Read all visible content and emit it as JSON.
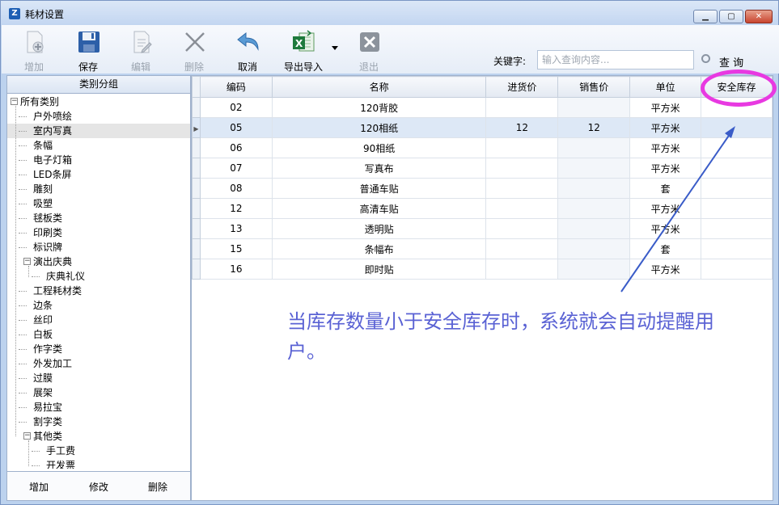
{
  "window": {
    "title": "耗材设置"
  },
  "toolbar": {
    "buttons": [
      {
        "id": "add",
        "label": "增加",
        "icon": "document-plus-icon",
        "enabled": false
      },
      {
        "id": "save",
        "label": "保存",
        "icon": "floppy-disk-icon",
        "enabled": true
      },
      {
        "id": "edit",
        "label": "编辑",
        "icon": "document-edit-icon",
        "enabled": false
      },
      {
        "id": "delete",
        "label": "删除",
        "icon": "x-cross-icon",
        "enabled": false
      },
      {
        "id": "cancel",
        "label": "取消",
        "icon": "undo-arrow-icon",
        "enabled": true
      },
      {
        "id": "export",
        "label": "导出导入",
        "icon": "excel-icon",
        "enabled": true
      },
      {
        "id": "exit",
        "label": "退出",
        "icon": "exit-x-icon",
        "enabled": false
      }
    ],
    "keyword_label": "关键字:",
    "search_placeholder": "输入查询内容...",
    "search_button": "查 询"
  },
  "left_panel": {
    "header": "类别分组",
    "footer_buttons": [
      "增加",
      "修改",
      "删除"
    ],
    "tree": [
      {
        "label": "所有类别",
        "level": 0,
        "expander": "−"
      },
      {
        "label": "户外喷绘",
        "level": 1
      },
      {
        "label": "室内写真",
        "level": 1,
        "selected": true
      },
      {
        "label": "条幅",
        "level": 1
      },
      {
        "label": "电子灯箱",
        "level": 1
      },
      {
        "label": "LED条屏",
        "level": 1
      },
      {
        "label": "雕刻",
        "level": 1
      },
      {
        "label": "吸塑",
        "level": 1
      },
      {
        "label": "毬板类",
        "level": 1
      },
      {
        "label": "印刷类",
        "level": 1
      },
      {
        "label": "标识牌",
        "level": 1
      },
      {
        "label": "演出庆典",
        "level": 1,
        "expander": "−"
      },
      {
        "label": "庆典礼仪",
        "level": 2
      },
      {
        "label": "工程耗材类",
        "level": 1
      },
      {
        "label": "边条",
        "level": 1
      },
      {
        "label": "丝印",
        "level": 1
      },
      {
        "label": "白板",
        "level": 1
      },
      {
        "label": "作字类",
        "level": 1
      },
      {
        "label": "外发加工",
        "level": 1
      },
      {
        "label": "过膜",
        "level": 1
      },
      {
        "label": "展架",
        "level": 1
      },
      {
        "label": "易拉宝",
        "level": 1
      },
      {
        "label": "割字类",
        "level": 1
      },
      {
        "label": "其他类",
        "level": 1,
        "expander": "−"
      },
      {
        "label": "手工费",
        "level": 2
      },
      {
        "label": "开发票",
        "level": 2
      }
    ]
  },
  "grid": {
    "columns": [
      "编码",
      "名称",
      "进货价",
      "销售价",
      "单位",
      "安全库存"
    ],
    "rows": [
      {
        "code": "02",
        "name": "120背胶",
        "buy": "",
        "sell": "",
        "unit": "平方米",
        "safety": ""
      },
      {
        "code": "05",
        "name": "120相纸",
        "buy": "12",
        "sell": "12",
        "unit": "平方米",
        "safety": "",
        "current": true
      },
      {
        "code": "06",
        "name": "90相纸",
        "buy": "",
        "sell": "",
        "unit": "平方米",
        "safety": ""
      },
      {
        "code": "07",
        "name": "写真布",
        "buy": "",
        "sell": "",
        "unit": "平方米",
        "safety": ""
      },
      {
        "code": "08",
        "name": "普通车贴",
        "buy": "",
        "sell": "",
        "unit": "套",
        "safety": ""
      },
      {
        "code": "12",
        "name": "高清车贴",
        "buy": "",
        "sell": "",
        "unit": "平方米",
        "safety": ""
      },
      {
        "code": "13",
        "name": "透明贴",
        "buy": "",
        "sell": "",
        "unit": "平方米",
        "safety": ""
      },
      {
        "code": "15",
        "name": "条幅布",
        "buy": "",
        "sell": "",
        "unit": "套",
        "safety": ""
      },
      {
        "code": "16",
        "name": "即时贴",
        "buy": "",
        "sell": "",
        "unit": "平方米",
        "safety": ""
      }
    ]
  },
  "annotation": {
    "text": "当库存数量小于安全库存时，系统就会自动提醒用户。",
    "circle_color": "#e839e1",
    "arrow_color": "#3a5cc8",
    "text_color": "#5a62d4"
  }
}
